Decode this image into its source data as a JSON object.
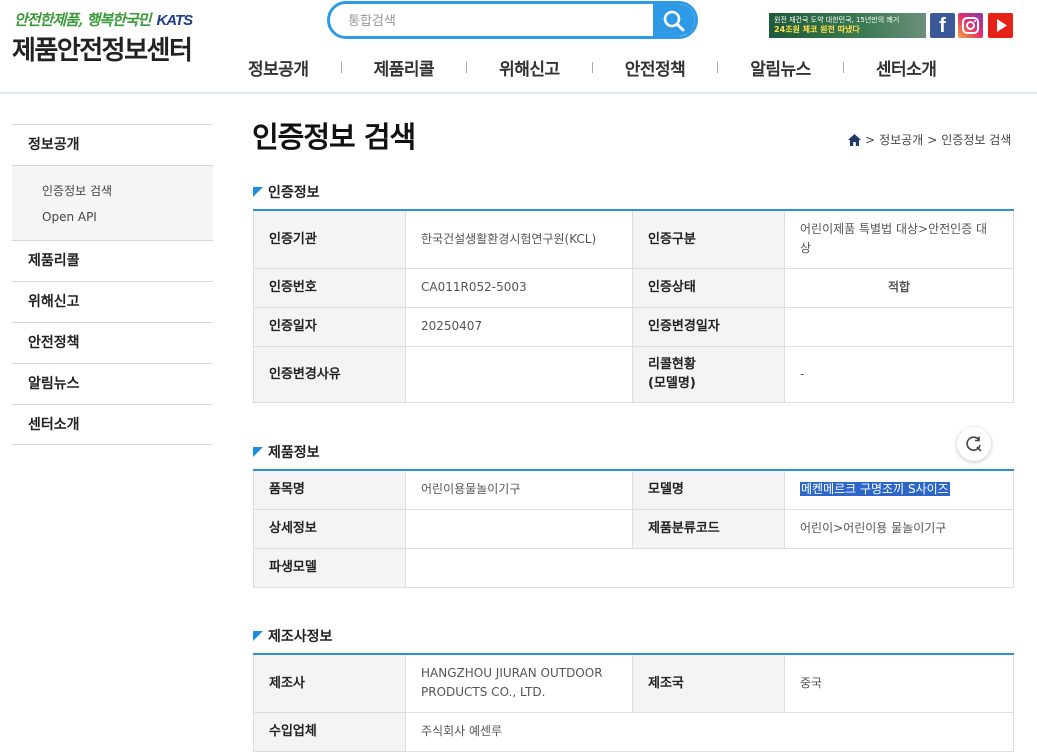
{
  "header": {
    "slogan": "안전한제품, 행복한국민",
    "katts_a": "KA",
    "katts_b": "TS",
    "site_title": "제품안전정보센터",
    "search_placeholder": "통합검색",
    "banner_line1": "원전 재건국 도약 대한민국, 15년만의 쾌거",
    "banner_line2": "24조원 체코 원전 따냈다",
    "sns": {
      "facebook": "f"
    }
  },
  "gnb": [
    "정보공개",
    "제품리콜",
    "위해신고",
    "안전정책",
    "알림뉴스",
    "센터소개"
  ],
  "sidebar": {
    "section": "정보공개",
    "sub_items": [
      "인증정보 검색",
      "Open API"
    ],
    "items": [
      "제품리콜",
      "위해신고",
      "안전정책",
      "알림뉴스",
      "센터소개"
    ]
  },
  "page": {
    "title": "인증정보 검색",
    "breadcrumb": [
      ">",
      "정보공개",
      ">",
      "인증정보 검색"
    ]
  },
  "cert": {
    "section_title": "인증정보",
    "agency_label": "인증기관",
    "agency": "한국건설생활환경시험연구원(KCL)",
    "type_label": "인증구분",
    "type": "어린이제품 특별법 대상>안전인증 대상",
    "number_label": "인증번호",
    "number": "CA011R052-5003",
    "status_label": "인증상태",
    "status": "적합",
    "date_label": "인증일자",
    "date": "20250407",
    "change_date_label": "인증변경일자",
    "change_date": "",
    "change_reason_label": "인증변경사유",
    "change_reason": "",
    "recall_label_1": "리콜현황",
    "recall_label_2": "(모델명)",
    "recall": "-"
  },
  "product": {
    "section_title": "제품정보",
    "item_label": "품목명",
    "item": "어린이용물놀이기구",
    "model_label": "모델명",
    "model": "메켄메르크 구명조끼 S사이즈",
    "detail_label": "상세정보",
    "detail": "",
    "class_label": "제품분류코드",
    "class": "어린이>어린이용 물놀이기구",
    "derived_label": "파생모델",
    "derived": ""
  },
  "maker": {
    "section_title": "제조사정보",
    "maker_label": "제조사",
    "maker_1": "HANGZHOU JIURAN OUTDOOR",
    "maker_2": "PRODUCTS CO., LTD.",
    "country_label": "제조국",
    "country": "중국",
    "importer_label": "수입업체",
    "importer": "주식회사 예센루"
  },
  "colors": {
    "accent": "#2e9ae6",
    "table_border": "#2e8fd6",
    "status": "#1a3dcc"
  }
}
